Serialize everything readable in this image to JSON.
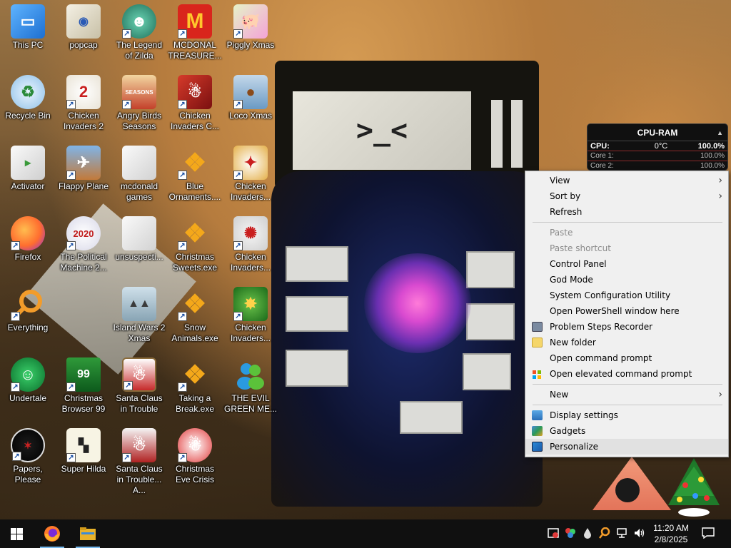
{
  "desktop": {
    "icons": [
      {
        "label": "This PC"
      },
      {
        "label": "popcap"
      },
      {
        "label": "The Legend of Zilda"
      },
      {
        "label": "MCDONAL TREASURE..."
      },
      {
        "label": "Piggly Xmas"
      },
      {
        "label": "Recycle Bin"
      },
      {
        "label": "Chicken Invaders 2"
      },
      {
        "label": "Angry Birds Seasons"
      },
      {
        "label": "Chicken Invaders C..."
      },
      {
        "label": "Loco Xmas"
      },
      {
        "label": "Activator"
      },
      {
        "label": "Flappy Plane"
      },
      {
        "label": "mcdonald games"
      },
      {
        "label": "Blue Ornaments...."
      },
      {
        "label": "Chicken Invaders..."
      },
      {
        "label": "Firefox"
      },
      {
        "label": "The Political Machine 2..."
      },
      {
        "label": "unsuspecti..."
      },
      {
        "label": "Christmas Sweets.exe"
      },
      {
        "label": "Chicken Invaders..."
      },
      {
        "label": "Everything"
      },
      {
        "label": "Island Wars 2 Xmas"
      },
      {
        "label": "Snow Animals.exe"
      },
      {
        "label": "Chicken Invaders..."
      },
      {
        "label": "Undertale"
      },
      {
        "label": "Christmas Browser 99"
      },
      {
        "label": "Santa Claus in Trouble"
      },
      {
        "label": "Taking a Break.exe"
      },
      {
        "label": "THE EVIL GREEN ME..."
      },
      {
        "label": "Papers, Please"
      },
      {
        "label": "Super Hilda"
      },
      {
        "label": "Santa Claus in Trouble... A..."
      },
      {
        "label": "Christmas Eve Crisis"
      }
    ],
    "icon_texts": {
      "mcdonalds": "M",
      "political_year": "2020",
      "browser_99": "99",
      "chicken_2": "2",
      "angry_seasons": "SEASONS"
    }
  },
  "wallpaper": {
    "face": ">_<"
  },
  "gadget": {
    "title": "CPU-RAM",
    "cpu_label": "CPU:",
    "cpu_temp": "0°C",
    "cpu_value": "100.0%",
    "core1_label": "Core 1:",
    "core1_value": "100.0%",
    "core2_label": "Core 2:",
    "core2_value": "100.0%"
  },
  "context_menu": {
    "view": "View",
    "sort_by": "Sort by",
    "refresh": "Refresh",
    "paste": "Paste",
    "paste_shortcut": "Paste shortcut",
    "control_panel": "Control Panel",
    "god_mode": "God Mode",
    "system_config": "System Configuration Utility",
    "powershell": "Open PowerShell window here",
    "steps_recorder": "Problem Steps Recorder",
    "new_folder": "New folder",
    "cmd": "Open command prompt",
    "elevated_cmd": "Open elevated command prompt",
    "new": "New",
    "display_settings": "Display settings",
    "gadgets": "Gadgets",
    "personalize": "Personalize"
  },
  "taskbar": {
    "time": "11:20 AM",
    "date": "2/8/2025"
  },
  "colors": {
    "accent": "#76b9ed",
    "taskbar": "#101010",
    "menu_bg": "#f0f0f0"
  }
}
